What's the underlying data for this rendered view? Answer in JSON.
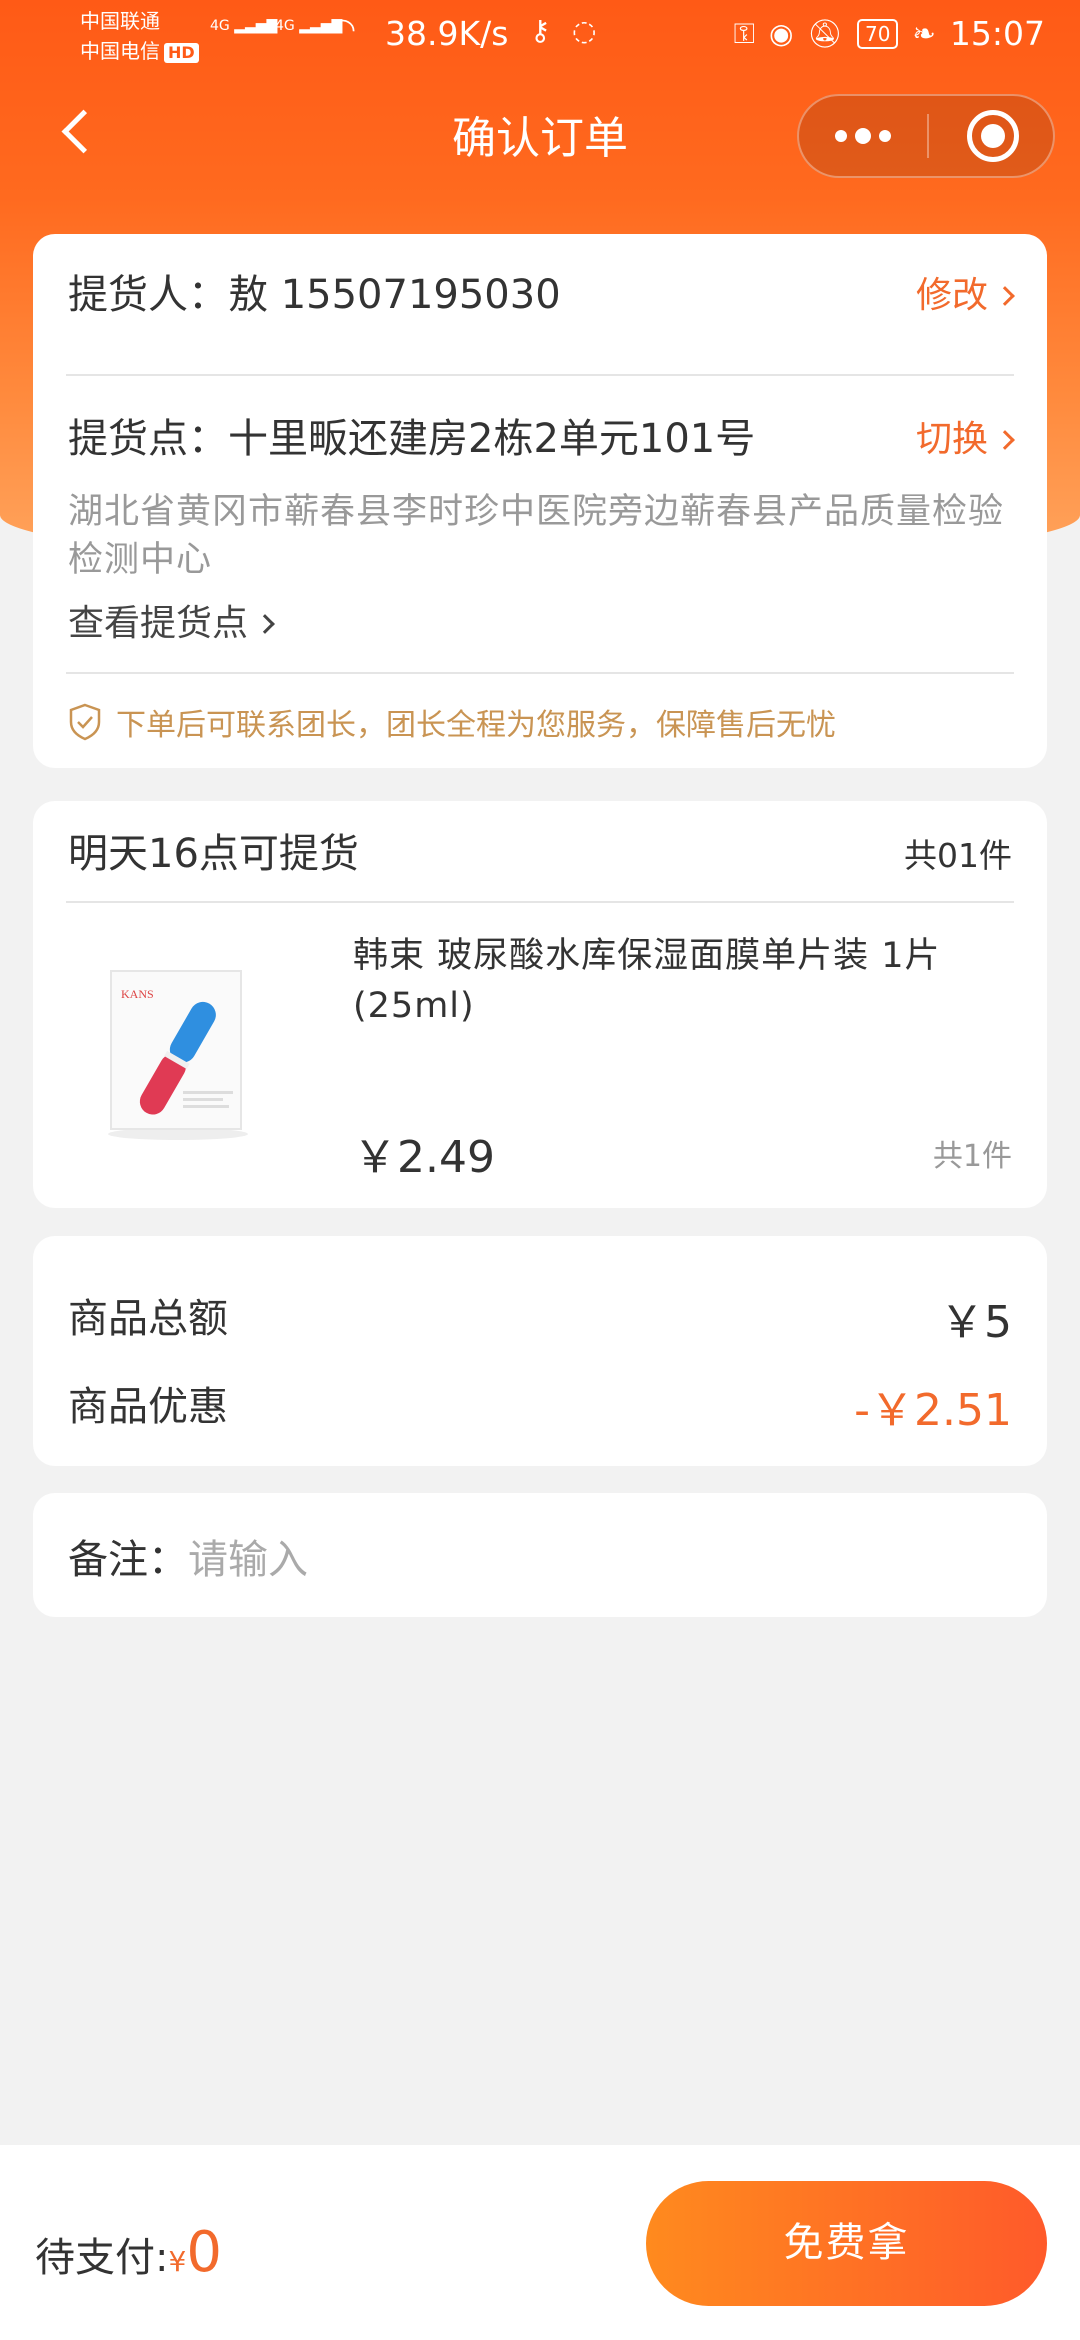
{
  "status_bar": {
    "carrier1": "中国联通",
    "carrier2": "中国电信",
    "hd": "HD",
    "net1": "4G",
    "net2": "4G",
    "speed": "38.9K/s",
    "battery": "70",
    "time": "15:07"
  },
  "nav": {
    "title": "确认订单"
  },
  "pickup": {
    "person_label": "提货人：",
    "person_value": "敖 15507195030",
    "edit_label": "修改",
    "point_label": "提货点：",
    "point_value": "十里畈还建房2栋2单元101号",
    "switch_label": "切换",
    "address": "湖北省黄冈市蕲春县李时珍中医院旁边蕲春县产品质量检验检测中心",
    "view_link": "查看提货点",
    "notice": "下单后可联系团长，团长全程为您服务，保障售后无忧"
  },
  "goods": {
    "pickup_time": "明天16点可提货",
    "total_count": "共01件",
    "image_brand": "KANS",
    "name": "韩束 玻尿酸水库保湿面膜单片装 1片(25ml)",
    "price": "￥2.49",
    "count": "共1件"
  },
  "amount": {
    "total_label": "商品总额",
    "total_value": "￥5",
    "discount_label": "商品优惠",
    "discount_value": "-￥2.51"
  },
  "remark": {
    "label": "备注：",
    "placeholder": "请输入"
  },
  "footer": {
    "pay_label": "待支付:",
    "pay_symbol": "¥",
    "pay_amount": "0",
    "button_label": "免费拿"
  },
  "colors": {
    "brand": "#ff5a16",
    "accent_text": "#f26a2c",
    "notice": "#c99453"
  }
}
